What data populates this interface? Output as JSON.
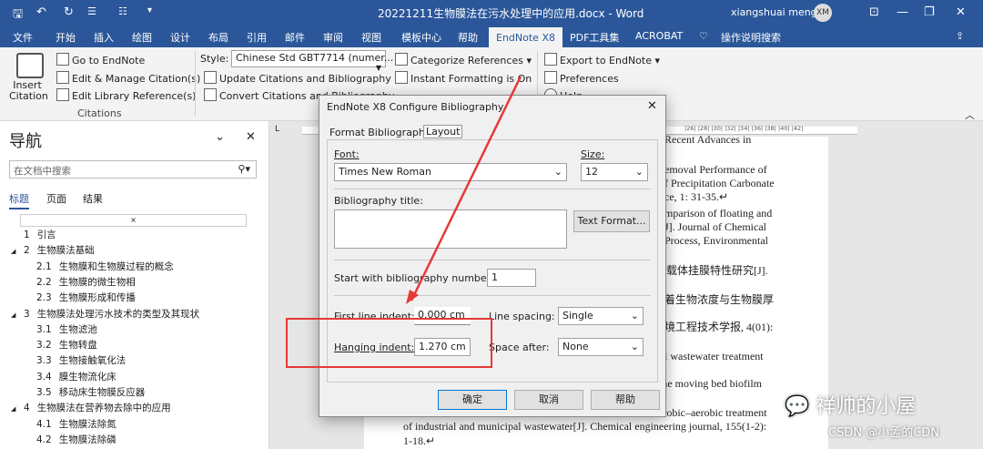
{
  "titlebar": {
    "title": "20221211生物膜法在污水处理中的应用.docx - Word",
    "user": "xiangshuai meng",
    "avatar": "XM"
  },
  "tabs": [
    "文件",
    "开始",
    "插入",
    "绘图",
    "设计",
    "布局",
    "引用",
    "邮件",
    "审阅",
    "视图",
    "模板中心",
    "帮助",
    "EndNote X8",
    "PDF工具集",
    "ACROBAT",
    "操作说明搜索"
  ],
  "ribbon": {
    "insert_citation": "Insert Citation",
    "go_to": "Go to EndNote",
    "edit_manage": "Edit & Manage Citation(s)",
    "edit_library": "Edit Library Reference(s)",
    "group_citations": "Citations",
    "style_label": "Style:",
    "style_value": "Chinese Std GBT7714 (numer...",
    "update": "Update Citations and Bibliography",
    "convert": "Convert Citations and Bibliography",
    "categorize": "Categorize References",
    "instant": "Instant Formatting is On",
    "export": "Export to EndNote",
    "preferences": "Preferences",
    "help": "Help"
  },
  "nav": {
    "title": "导航",
    "search_placeholder": "在文档中搜索",
    "tabs": [
      "标题",
      "页面",
      "结果"
    ],
    "items": [
      {
        "num": "1",
        "text": "引言",
        "level": 1,
        "arrow": ""
      },
      {
        "num": "2",
        "text": "生物膜法基础",
        "level": 1,
        "arrow": "◢"
      },
      {
        "num": "2.1",
        "text": "生物膜和生物膜过程的概念",
        "level": 2,
        "arrow": ""
      },
      {
        "num": "2.2",
        "text": "生物膜的微生物相",
        "level": 2,
        "arrow": ""
      },
      {
        "num": "2.3",
        "text": "生物膜形成和传播",
        "level": 2,
        "arrow": ""
      },
      {
        "num": "3",
        "text": "生物膜法处理污水技术的类型及其现状",
        "level": 1,
        "arrow": "◢"
      },
      {
        "num": "3.1",
        "text": "生物滤池",
        "level": 2,
        "arrow": ""
      },
      {
        "num": "3.2",
        "text": "生物转盘",
        "level": 2,
        "arrow": ""
      },
      {
        "num": "3.3",
        "text": "生物接触氧化法",
        "level": 2,
        "arrow": ""
      },
      {
        "num": "3.4",
        "text": "膜生物流化床",
        "level": 2,
        "arrow": ""
      },
      {
        "num": "3.5",
        "text": "移动床生物膜反应器",
        "level": 2,
        "arrow": ""
      },
      {
        "num": "4",
        "text": "生物膜法在营养物去除中的应用",
        "level": 1,
        "arrow": "◢"
      },
      {
        "num": "4.1",
        "text": "生物膜法除氮",
        "level": 2,
        "arrow": ""
      },
      {
        "num": "4.2",
        "text": "生物膜法除磷",
        "level": 2,
        "arrow": ""
      }
    ]
  },
  "ruler": "|26| |28| |30| |32| |34| |36| |38| |40| |42|",
  "doc_lines": [
    "Recent Advances in",
    "emoval Performance of",
    "f Precipitation Carbonate",
    "ce, 1: 31-35.↵",
    "mparison of floating and",
    "J]. Journal of Chemical",
    "Process, Environmental",
    "东载体挂膜特性研究[J].",
    "着生物浓度与生物膜厚",
    "境工程技术学报, 4(01):",
    "l     wastewater     treatment",
    "-the moving bed biofilm",
    "erobic–aerobic treatment",
    "of industrial and municipal wastewater[J]. Chemical engineering journal, 155(1-2):",
    "1-18.↵"
  ],
  "dialog": {
    "title": "EndNote X8 Configure Bibliography",
    "tab_format": "Format Bibliography",
    "tab_layout": "Layout",
    "font_label": "Font:",
    "font_value": "Times New Roman",
    "size_label": "Size:",
    "size_value": "12",
    "bib_title_label": "Bibliography title:",
    "text_format": "Text Format...",
    "start_label": "Start with bibliography number:",
    "start_value": "1",
    "first_indent_label": "First line indent:",
    "first_indent_value": "0.000 cm",
    "line_spacing_label": "Line spacing:",
    "line_spacing_value": "Single",
    "hanging_label": "Hanging indent:",
    "hanging_value": "1.270 cm",
    "space_after_label": "Space after:",
    "space_after_value": "None",
    "ok": "确定",
    "cancel": "取消",
    "help": "帮助"
  },
  "watermark": {
    "line1": "祥帅的小屋",
    "line2": "CSDN @小孟的CDN"
  },
  "colors": {
    "word_blue": "#2b579a",
    "highlight_red": "#e53935"
  }
}
